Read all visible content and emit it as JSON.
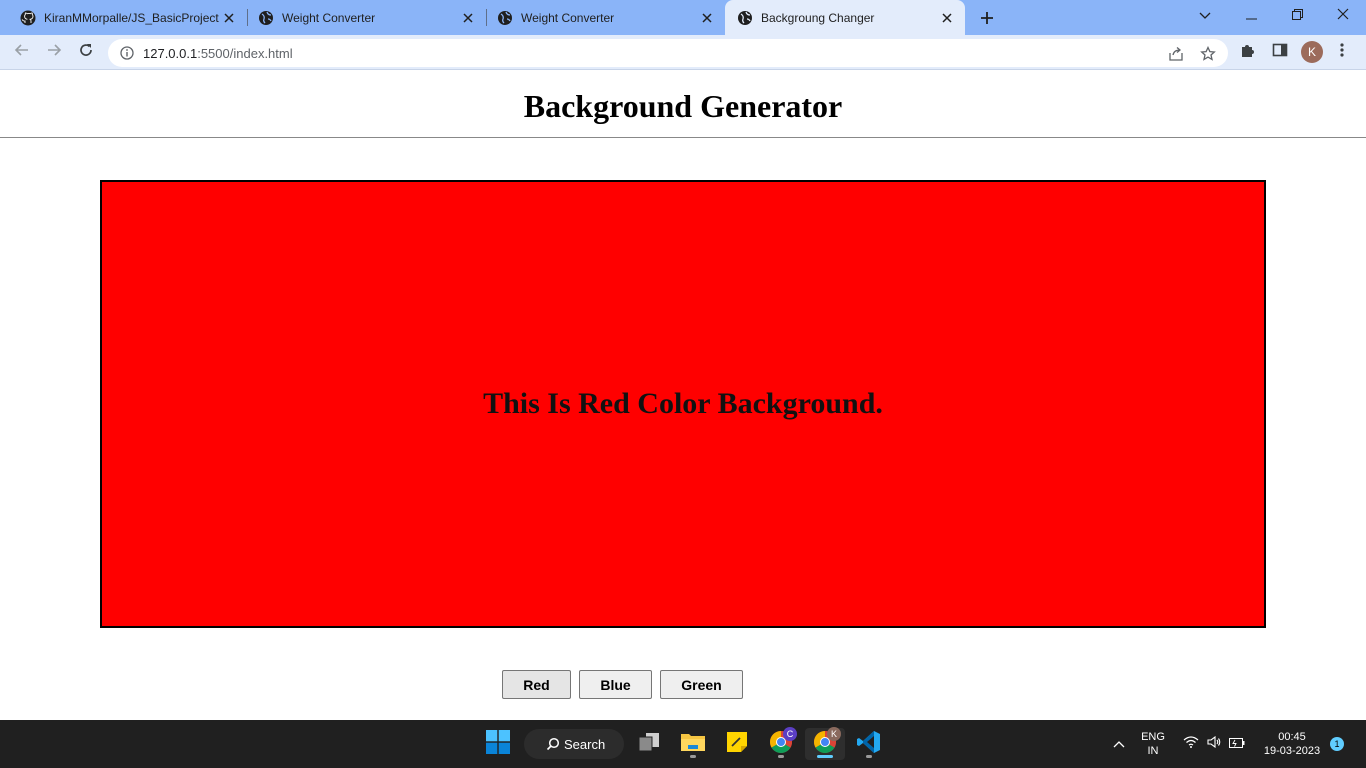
{
  "browser": {
    "tabs": [
      {
        "title": "KiranMMorpalle/JS_BasicProject",
        "icon": "github-icon",
        "active": false
      },
      {
        "title": "Weight Converter",
        "icon": "globe-icon",
        "active": false
      },
      {
        "title": "Weight Converter",
        "icon": "globe-icon",
        "active": false
      },
      {
        "title": "Backgroung Changer",
        "icon": "globe-icon",
        "active": true
      }
    ],
    "url_host": "127.0.0.1",
    "url_path": ":5500/index.html",
    "profile_initial": "K"
  },
  "page": {
    "heading": "Background Generator",
    "message": "This Is Red Color Background.",
    "box_color": "#ff0000",
    "buttons": {
      "red": "Red",
      "blue": "Blue",
      "green": "Green"
    }
  },
  "taskbar": {
    "search_label": "Search",
    "language": "ENG",
    "region": "IN",
    "time": "00:45",
    "date": "19-03-2023",
    "notification_count": "1",
    "chrome_profile_c": "C",
    "chrome_profile_k": "K"
  },
  "colors": {
    "tabstrip": "#8ab4f8",
    "toolbar": "#e3ecfb",
    "taskbar": "#202020",
    "accent": "#60cdff"
  }
}
